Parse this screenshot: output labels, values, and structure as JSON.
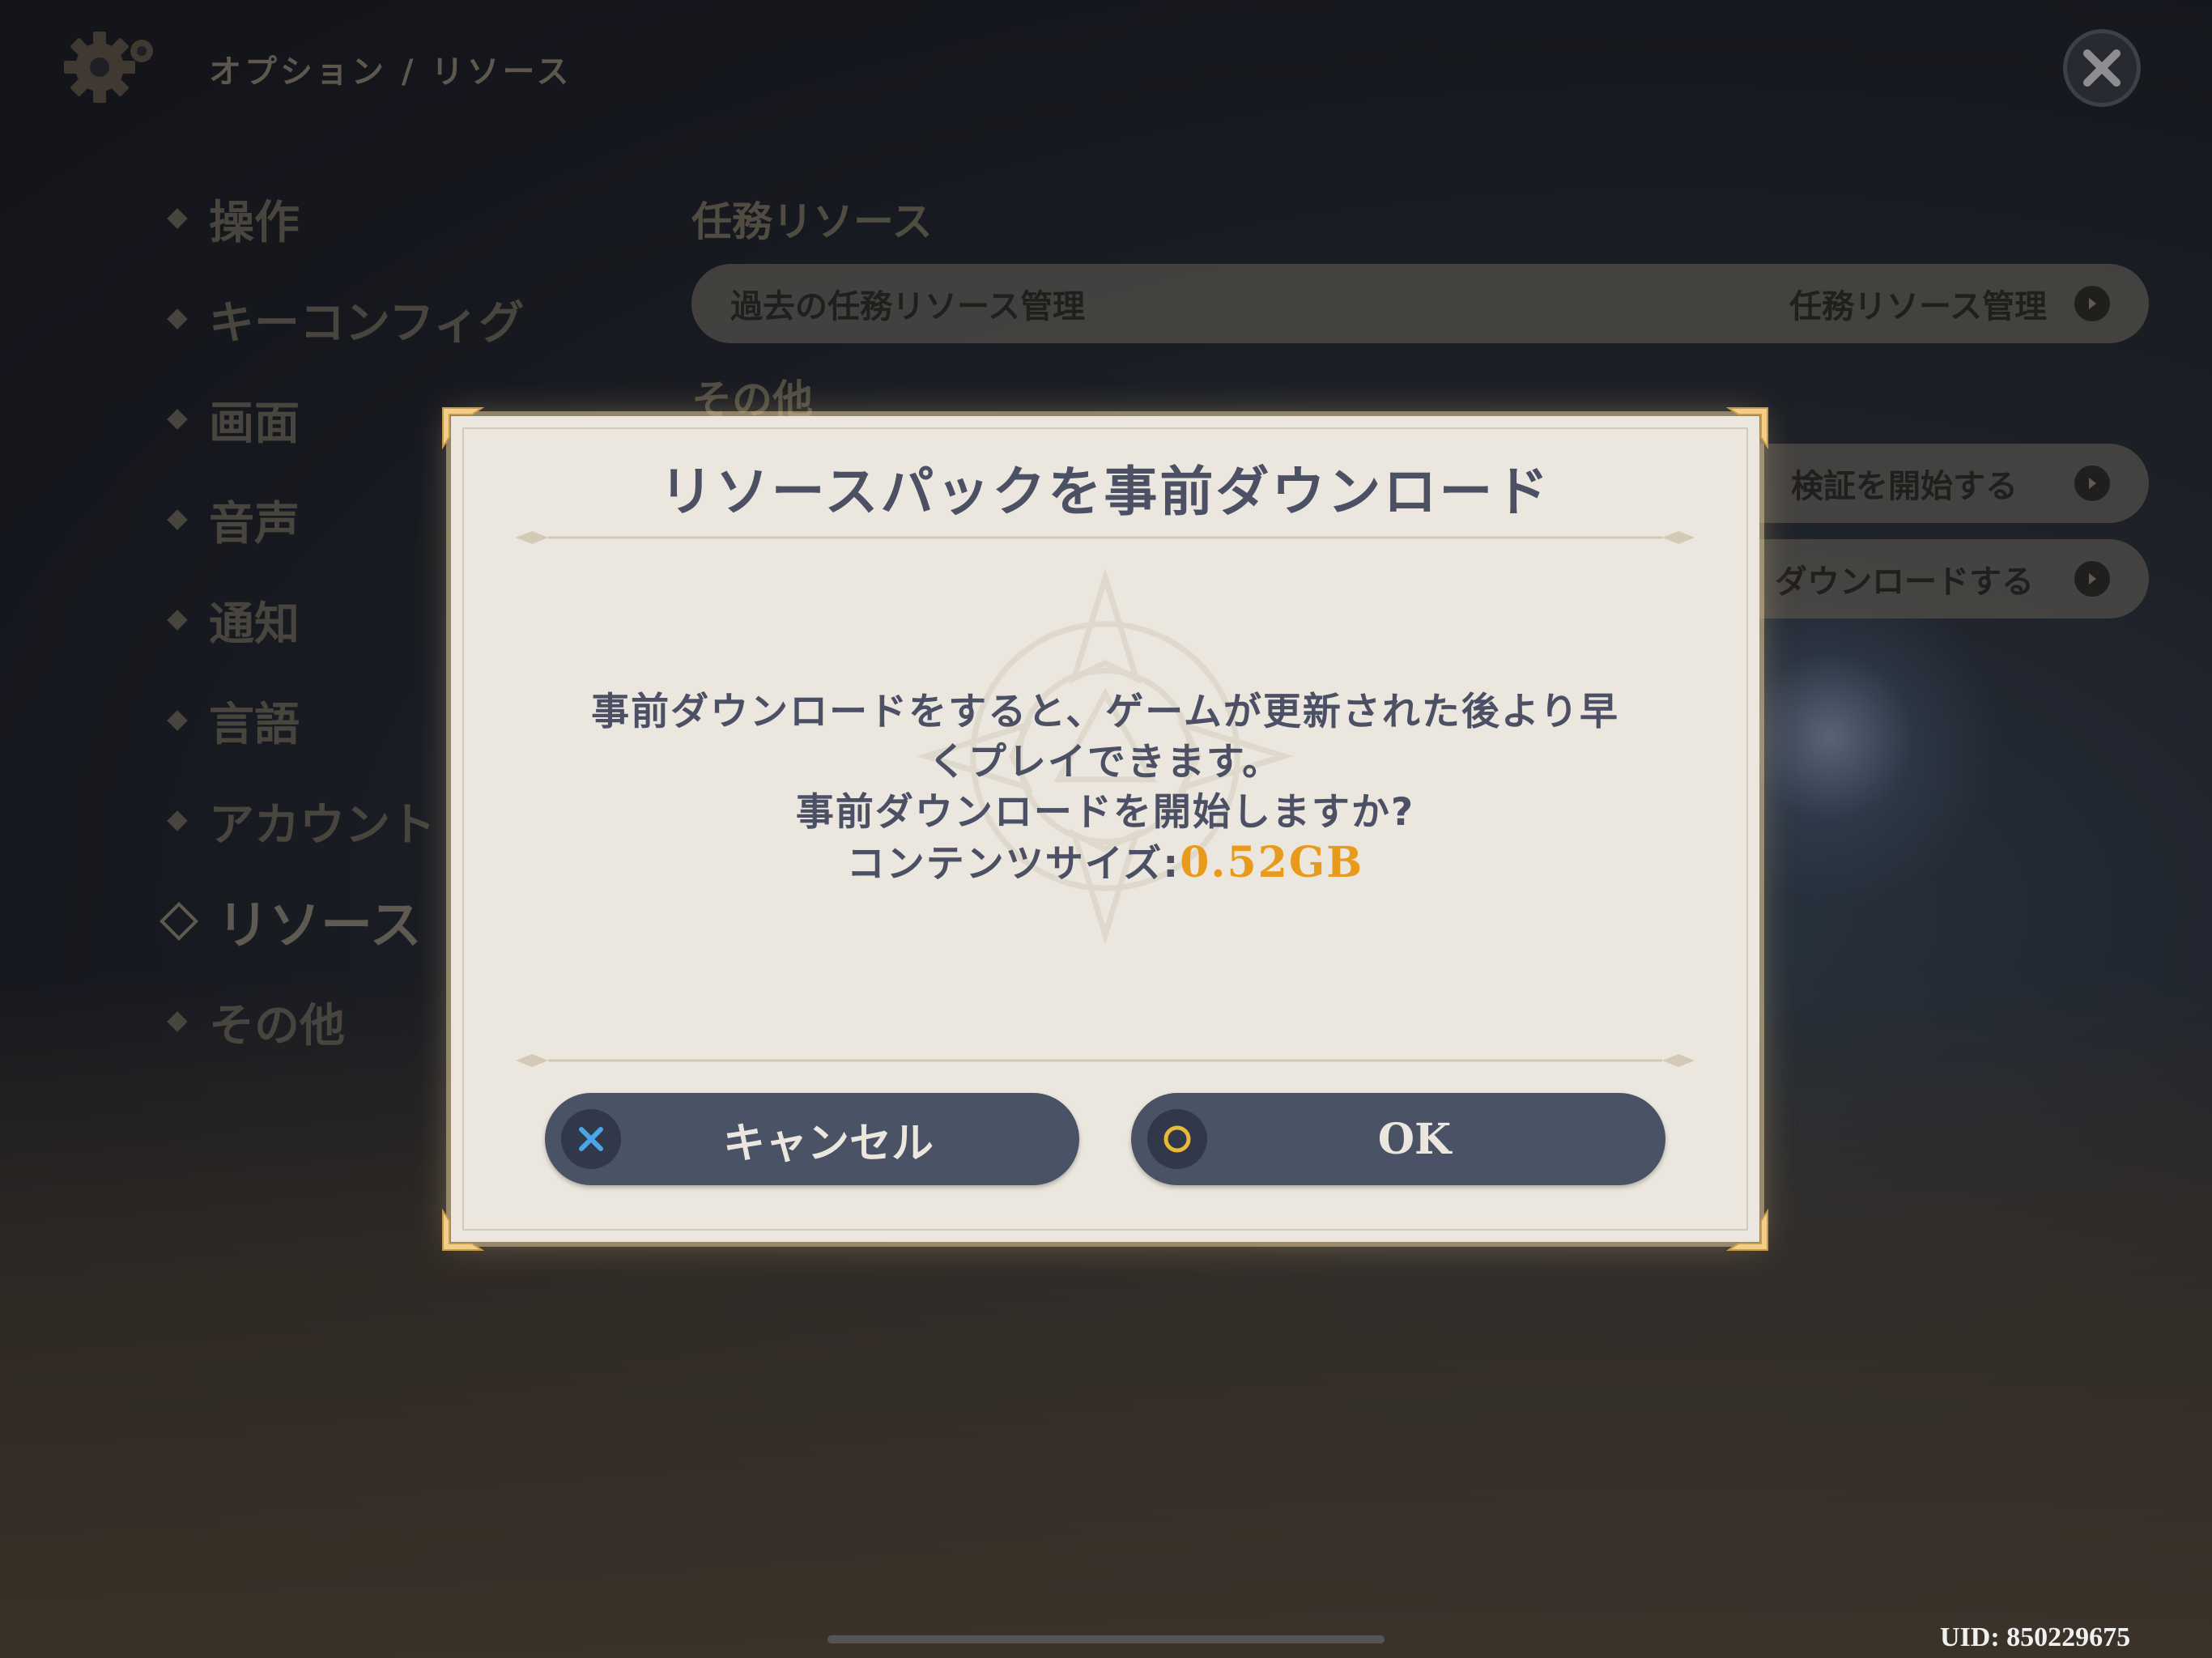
{
  "header": {
    "breadcrumb": "オプション / リソース",
    "settings_icon": "gear-icon",
    "close_icon": "close-icon"
  },
  "menu": {
    "items": [
      {
        "label": "操作",
        "active": false
      },
      {
        "label": "キーコンフィグ",
        "active": false
      },
      {
        "label": "画面",
        "active": false
      },
      {
        "label": "音声",
        "active": false
      },
      {
        "label": "通知",
        "active": false
      },
      {
        "label": "言語",
        "active": false
      },
      {
        "label": "アカウント",
        "active": false
      },
      {
        "label": "リソース",
        "active": true
      },
      {
        "label": "その他",
        "active": false
      }
    ]
  },
  "panel": {
    "section1_title": "任務リソース",
    "row1": {
      "label": "過去の任務リソース管理",
      "action": "任務リソース管理"
    },
    "section2_title": "その他",
    "row2": {
      "action": "検証を開始する"
    },
    "row3": {
      "action": "ダウンロードする"
    }
  },
  "dialog": {
    "title": "リソースパックを事前ダウンロード",
    "message_line1": "事前ダウンロードをすると、ゲームが更新された後より早",
    "message_line2": "くプレイできます。",
    "message_line3": "事前ダウンロードを開始しますか?",
    "size_label": "コンテンツサイズ:",
    "size_value": "0.52GB",
    "cancel_label": "キャンセル",
    "ok_label": "OK"
  },
  "footer": {
    "uid": "UID: 850229675"
  },
  "colors": {
    "accent_orange": "#e79a1c",
    "button_bg": "#4a5265",
    "dialog_bg": "#ece7de",
    "cross_blue": "#4aa6e8",
    "circle_yellow": "#e9b93a"
  }
}
